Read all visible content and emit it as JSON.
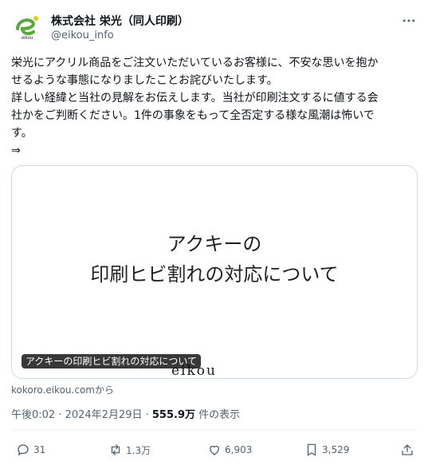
{
  "account": {
    "name": "株式会社 栄光（同人印刷）",
    "handle": "@eikou_info",
    "avatar_text": "eikou"
  },
  "tweet": {
    "lines": [
      "栄光にアクリル商品をご注文いただいているお客様に、不安な思いを抱か",
      "せるような事態になりましたことお詫びいたします。",
      "詳しい経緯と当社の見解をお伝えします。当社が印刷注文するに値する会",
      "社かをご判断ください。1件の事象をもって全否定する様な風潮は怖いで",
      "す。",
      "⇒"
    ]
  },
  "card": {
    "title_line1": "アクキーの",
    "title_line2": "印刷ヒビ割れの対応について",
    "brand": "eikou",
    "overlay_label": "アクキーの印刷ヒビ割れの対応について",
    "source": "kokoro.eikou.comから"
  },
  "meta": {
    "timestamp": "午後0:02 · 2024年2月29日 · ",
    "views_count": "555.9万",
    "views_label": " 件の表示"
  },
  "actions": {
    "replies": "31",
    "retweets": "1.3万",
    "likes": "6,903",
    "bookmarks": "3,529"
  },
  "colors": {
    "text": "#0f1419",
    "muted": "#536471",
    "border": "#cfd9de",
    "avatar_green": "#5aa83c"
  },
  "icons": [
    "eikou-logo-icon",
    "more-icon",
    "reply-icon",
    "retweet-icon",
    "like-icon",
    "bookmark-icon",
    "share-icon"
  ]
}
